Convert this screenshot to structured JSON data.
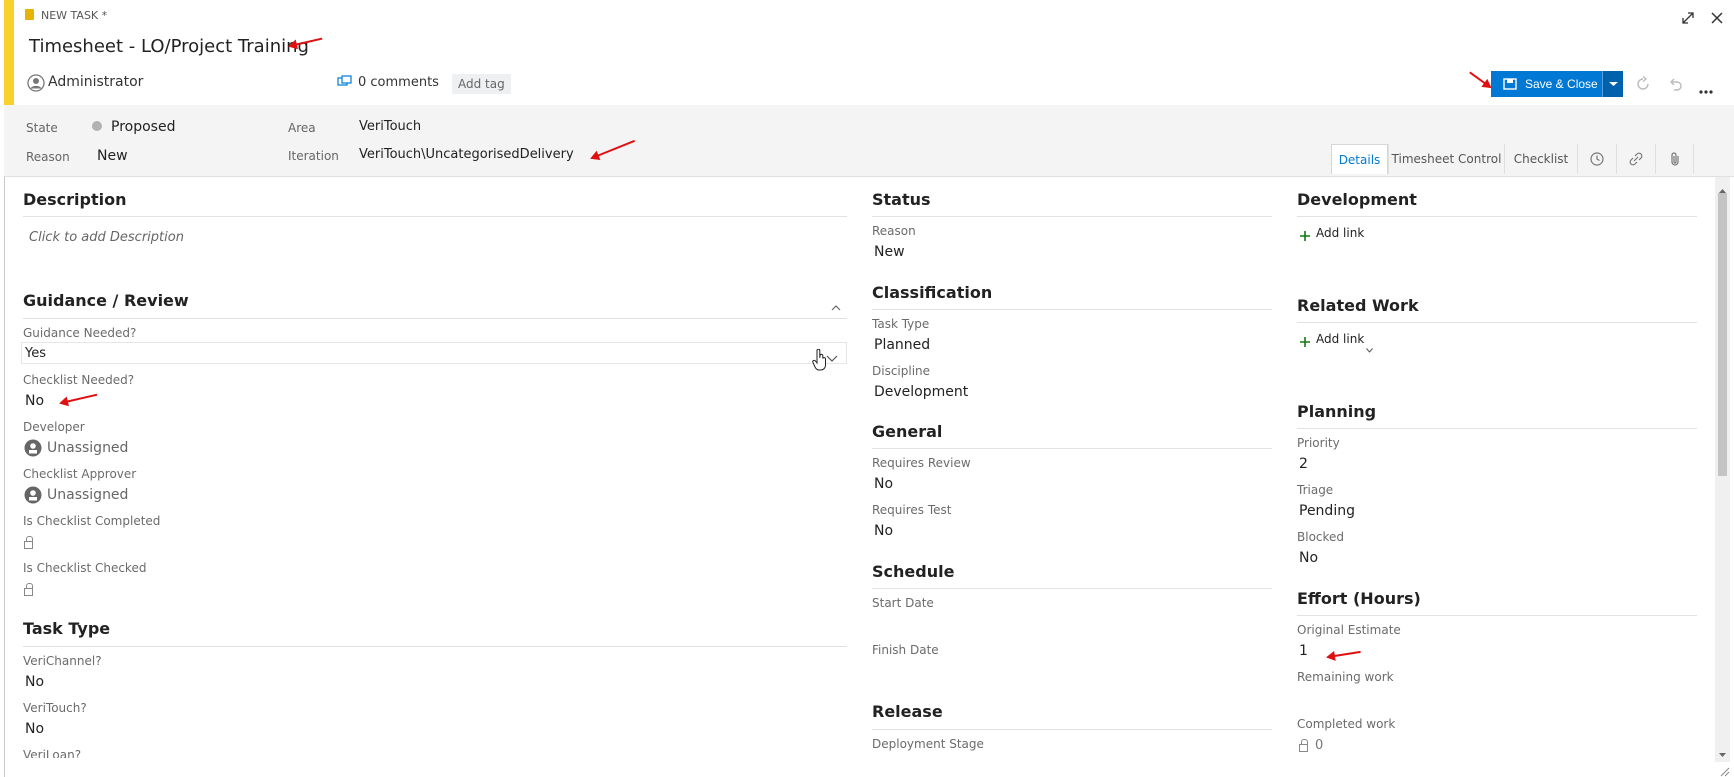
{
  "header": {
    "kind_label": "NEW TASK *",
    "title": "Timesheet - LO/Project Training",
    "assigned_to": "Administrator",
    "comments": "0 comments",
    "add_tag": "Add tag",
    "save_close": "Save & Close"
  },
  "fields": {
    "state_label": "State",
    "state_value": "Proposed",
    "reason_label": "Reason",
    "reason_value": "New",
    "area_label": "Area",
    "area_value": "VeriTouch",
    "iteration_label": "Iteration",
    "iteration_value": "VeriTouch\\UncategorisedDelivery"
  },
  "tabs": [
    "Details",
    "Timesheet Control",
    "Checklist"
  ],
  "left": {
    "description_title": "Description",
    "description_placeholder": "Click to add Description",
    "guidance_title": "Guidance / Review",
    "guidance_needed_label": "Guidance Needed?",
    "guidance_needed_value": "Yes",
    "checklist_needed_label": "Checklist Needed?",
    "checklist_needed_value": "No",
    "developer_label": "Developer",
    "developer_value": "Unassigned",
    "checklist_approver_label": "Checklist Approver",
    "checklist_approver_value": "Unassigned",
    "is_checklist_completed_label": "Is Checklist Completed",
    "is_checklist_checked_label": "Is Checklist Checked",
    "task_type_title": "Task Type",
    "verichannel_label": "VeriChannel?",
    "verichannel_value": "No",
    "veritouch_label": "VeriTouch?",
    "veritouch_value": "No",
    "veriloan_label": "VeriLoan?"
  },
  "middle": {
    "status_title": "Status",
    "reason_label": "Reason",
    "reason_value": "New",
    "classification_title": "Classification",
    "task_type_label": "Task Type",
    "task_type_value": "Planned",
    "discipline_label": "Discipline",
    "discipline_value": "Development",
    "general_title": "General",
    "requires_review_label": "Requires Review",
    "requires_review_value": "No",
    "requires_test_label": "Requires Test",
    "requires_test_value": "No",
    "schedule_title": "Schedule",
    "start_date_label": "Start Date",
    "finish_date_label": "Finish Date",
    "release_title": "Release",
    "deployment_stage_label": "Deployment Stage"
  },
  "right": {
    "development_title": "Development",
    "add_link": "Add link",
    "related_work_title": "Related Work",
    "add_link_related": "Add link",
    "planning_title": "Planning",
    "priority_label": "Priority",
    "priority_value": "2",
    "triage_label": "Triage",
    "triage_value": "Pending",
    "blocked_label": "Blocked",
    "blocked_value": "No",
    "effort_title": "Effort (Hours)",
    "original_estimate_label": "Original Estimate",
    "original_estimate_value": "1",
    "remaining_work_label": "Remaining work",
    "completed_work_label": "Completed work",
    "completed_work_value": "0"
  },
  "colors": {
    "accent": "#f8d22a",
    "primary": "#0078d4",
    "annotation": "#e01010"
  }
}
